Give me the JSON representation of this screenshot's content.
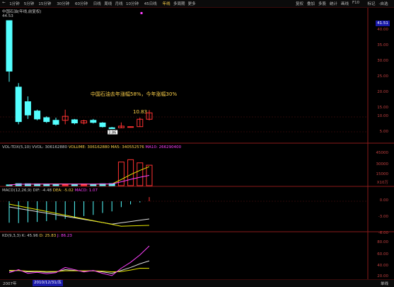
{
  "toolbar": {
    "left_items": [
      "←",
      "1分钟",
      "5分钟",
      "15分钟",
      "30分钟",
      "60分钟",
      "日线",
      "周线",
      "月线",
      "10分钟",
      "45日线",
      "年线",
      "多周期",
      "更多"
    ],
    "active_left": "年线",
    "right_items": [
      "复权",
      "叠加",
      "多股",
      "统计",
      "画线",
      "F10",
      "标记",
      "-自选",
      "返回"
    ]
  },
  "price_header": "中国石油(年线,前复权)",
  "price_max_label": "44.53",
  "price_axis": [
    "40.00",
    "35.00",
    "30.00",
    "25.00",
    "20.00",
    "15.00",
    "10.00",
    "5.00"
  ],
  "current_price_tag": "41.51",
  "annotation_text": "中国石油去年涨幅58%，今年涨幅30%",
  "annotation_price": "10.83",
  "low_label": "3.86",
  "vol_header": {
    "name": "VOL-TDX(5,10)",
    "vvol": "VVOL: 306162880",
    "volume": "VOLUME: 306162880",
    "ma5": "MA5: 340552576",
    "ma10": "MA10: 266290400"
  },
  "vol_axis": [
    "45000",
    "30000",
    "15000",
    "X10万"
  ],
  "macd_header": {
    "name": "MACD(12,26,9)",
    "dif": "DIF: -4.48",
    "dea": "DEA: -5.02",
    "macd": "MACD: 1.07"
  },
  "macd_axis": [
    "0.00",
    "-3.00",
    "-6.00"
  ],
  "kd_header": {
    "name": "KD(9,3,3)",
    "k": "K: 45.96",
    "d": "D: 25.83",
    "j": "J: 86.23"
  },
  "kd_axis": [
    "80.00",
    "60.00",
    "40.00",
    "20.00"
  ],
  "bottom": {
    "start_year": "2007年",
    "cursor_date": "2010/12/31/五",
    "right_label": "单线"
  },
  "colors": {
    "up": "#ff3232",
    "down": "#54ffff",
    "ma_yellow": "#e6e600",
    "magenta": "#ff40ff",
    "text_yellow": "#ffd24a"
  },
  "chart_data": {
    "type": "candlestick",
    "period": "year",
    "candles": [
      {
        "open": 44.5,
        "close": 25.5,
        "high": 44.5,
        "low": 21.5
      },
      {
        "open": 19.5,
        "close": 6.5,
        "high": 21.0,
        "low": 5.5
      },
      {
        "open": 14.0,
        "close": 9.0,
        "high": 16.0,
        "low": 7.5
      },
      {
        "open": 10.5,
        "close": 7.5,
        "high": 11.0,
        "low": 7.0
      },
      {
        "open": 8.0,
        "close": 6.5,
        "high": 8.5,
        "low": 6.0
      },
      {
        "open": 7.0,
        "close": 5.5,
        "high": 8.0,
        "low": 5.0
      },
      {
        "open": 7.0,
        "close": 8.5,
        "high": 11.0,
        "low": 5.5
      },
      {
        "open": 7.2,
        "close": 6.0,
        "high": 7.5,
        "low": 5.5
      },
      {
        "open": 6.0,
        "close": 6.8,
        "high": 7.2,
        "low": 5.5
      },
      {
        "open": 7.0,
        "close": 6.2,
        "high": 7.5,
        "low": 5.8
      },
      {
        "open": 6.0,
        "close": 4.6,
        "high": 6.3,
        "low": 4.3
      },
      {
        "open": 4.2,
        "close": 3.86,
        "high": 4.5,
        "low": 3.86
      },
      {
        "open": 4.2,
        "close": 4.8,
        "high": 6.2,
        "low": 4.0
      },
      {
        "open": 4.4,
        "close": 4.6,
        "high": 4.7,
        "low": 4.3
      },
      {
        "open": 4.6,
        "close": 7.4,
        "high": 8.0,
        "low": 4.6
      },
      {
        "open": 7.4,
        "close": 9.8,
        "high": 10.83,
        "low": 7.0
      }
    ],
    "volume": [
      1000,
      2500,
      2400,
      2300,
      2200,
      2000,
      1800,
      1900,
      2000,
      1900,
      2400,
      2600,
      30000,
      33000,
      29000,
      26000
    ],
    "volume_up": [
      false,
      false,
      false,
      false,
      false,
      false,
      true,
      false,
      true,
      false,
      false,
      false,
      true,
      true,
      true,
      true
    ],
    "macd_bars": [
      -5.5,
      -5.6,
      -5.4,
      -5.3,
      -5.1,
      -4.8,
      -4.5,
      -4.2,
      -3.8,
      -3.5,
      -3.0,
      -2.6,
      -1.5,
      -0.8,
      -0.3,
      1.07
    ],
    "kd_k": [
      18,
      20,
      16,
      17,
      15,
      16,
      22,
      20,
      18,
      19,
      16,
      12,
      20,
      28,
      38,
      45.96
    ],
    "kd_d": [
      20,
      20,
      18,
      18,
      17,
      17,
      19,
      19,
      19,
      19,
      18,
      16,
      17,
      21,
      26,
      25.83
    ],
    "kd_j": [
      14,
      22,
      12,
      15,
      11,
      14,
      28,
      22,
      16,
      20,
      12,
      6,
      26,
      42,
      62,
      86.23
    ]
  }
}
